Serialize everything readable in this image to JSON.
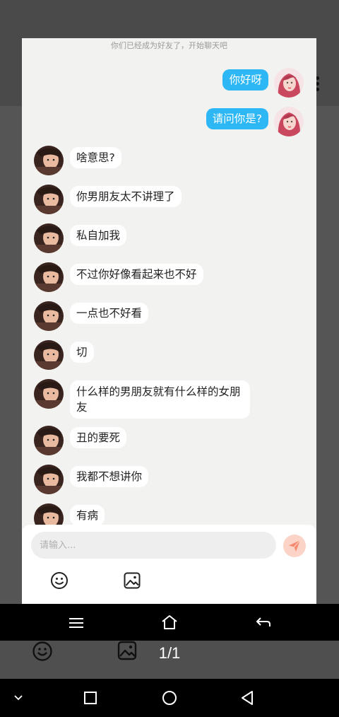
{
  "chat": {
    "system_note": "你们已经成为好友了，开始聊天吧",
    "messages": [
      {
        "side": "out",
        "text": "你好呀"
      },
      {
        "side": "out",
        "text": "请问你是?"
      },
      {
        "side": "in",
        "text": "啥意思?"
      },
      {
        "side": "in",
        "text": "你男朋友太不讲理了"
      },
      {
        "side": "in",
        "text": "私自加我"
      },
      {
        "side": "in",
        "text": "不过你好像看起来也不好"
      },
      {
        "side": "in",
        "text": "一点也不好看"
      },
      {
        "side": "in",
        "text": "切"
      },
      {
        "side": "in",
        "text": "什么样的男朋友就有什么样的女朋友"
      },
      {
        "side": "in",
        "text": "丑的要死"
      },
      {
        "side": "in",
        "text": "我都不想讲你"
      },
      {
        "side": "in",
        "text": "有病"
      }
    ]
  },
  "composer": {
    "placeholder": "请输入...",
    "emoji_icon": "smiley-icon",
    "image_icon": "image-icon",
    "send_icon": "paper-plane-icon",
    "send_color": "#f58a6e"
  },
  "viewer": {
    "page_counter": "1/1"
  },
  "colors": {
    "outgoing_bubble": "#2db7f5",
    "incoming_bubble": "#ffffff",
    "chat_background": "#f2f3f0"
  }
}
